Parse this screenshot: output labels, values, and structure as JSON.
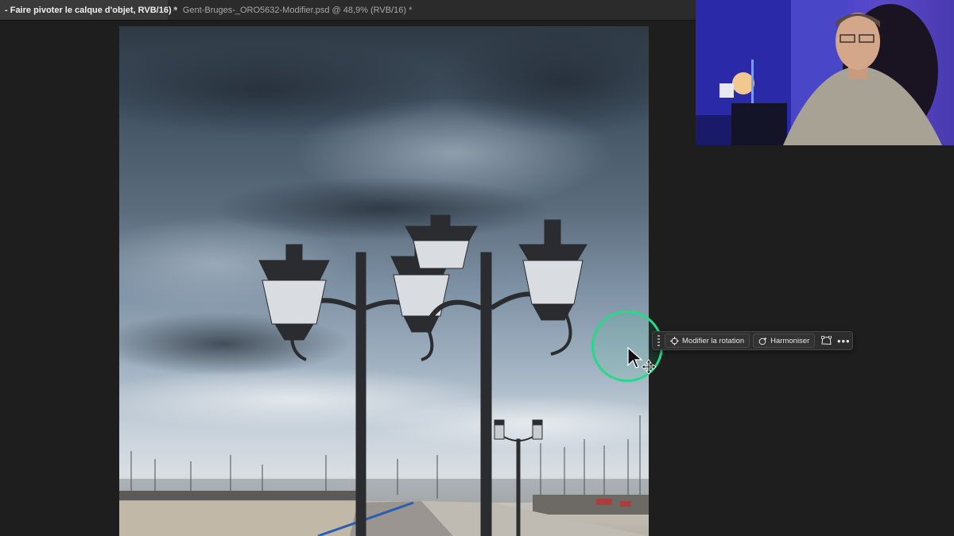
{
  "tabs": [
    {
      "label": "- Faire pivoter le calque d'objet, RVB/16) *",
      "active": true
    },
    {
      "label": "Gent-Bruges-_ORO5632-Modifier.psd @ 48,9% (RVB/16) *",
      "active": false,
      "close_icon": "×"
    }
  ],
  "taskbar": {
    "rotate_label": "Modifier la rotation",
    "harmonize_label": "Harmoniser",
    "more_label": "•••"
  },
  "colors": {
    "app_background": "#1e1e1e",
    "tab_active": "#3a3a3a",
    "cursor_highlight": "#27d98a",
    "taskbar_bg": "#2d2d2d"
  },
  "icons": [
    "close-icon",
    "rotate-crosshair-icon",
    "harmonize-sparkle-icon",
    "perspective-warp-icon",
    "more-icon",
    "mouse-pointer-icon",
    "move-icon",
    "grip-icon"
  ]
}
